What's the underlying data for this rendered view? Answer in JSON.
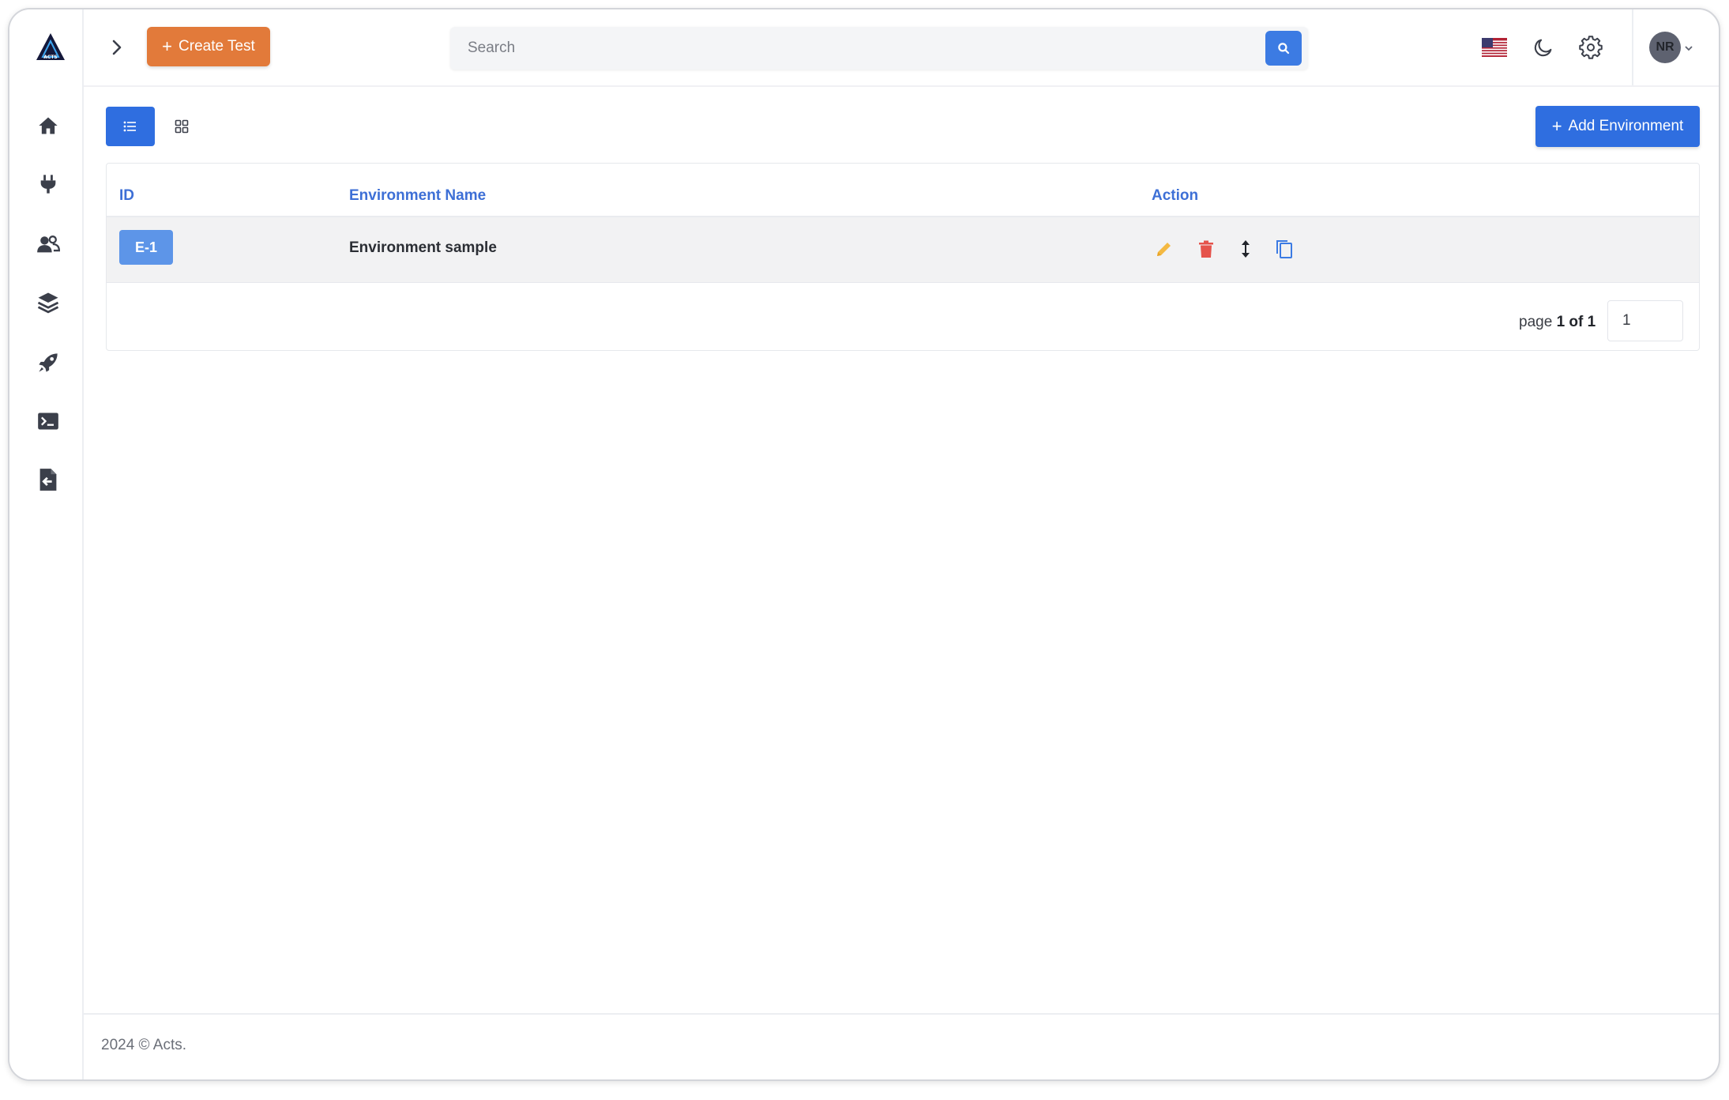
{
  "app": {
    "name": "Acts",
    "logo_text": "ACTS"
  },
  "topbar": {
    "create_button_label": "Create Test",
    "search_placeholder": "Search",
    "user_initials": "NR"
  },
  "sidebar": {
    "items": [
      {
        "name": "home",
        "icon": "home-icon"
      },
      {
        "name": "plugins",
        "icon": "plug-icon"
      },
      {
        "name": "users",
        "icon": "users-icon"
      },
      {
        "name": "layers",
        "icon": "layers-icon"
      },
      {
        "name": "rocket",
        "icon": "rocket-icon"
      },
      {
        "name": "terminal",
        "icon": "terminal-icon"
      },
      {
        "name": "import",
        "icon": "file-import-icon"
      }
    ]
  },
  "toolbar": {
    "add_environment_label": "Add Environment"
  },
  "table": {
    "columns": [
      "ID",
      "Environment Name",
      "Action"
    ],
    "rows": [
      {
        "id": "E-1",
        "name": "Environment sample"
      }
    ]
  },
  "pagination": {
    "prefix": "page",
    "current": "1 of 1",
    "input_value": "1"
  },
  "footer": {
    "text": "2024 © Acts."
  },
  "colors": {
    "primary": "#2f6ee0",
    "create_button": "#e27a3a",
    "badge": "#5d95e8",
    "edit_icon": "#f4b942",
    "delete_icon": "#e5534b"
  }
}
